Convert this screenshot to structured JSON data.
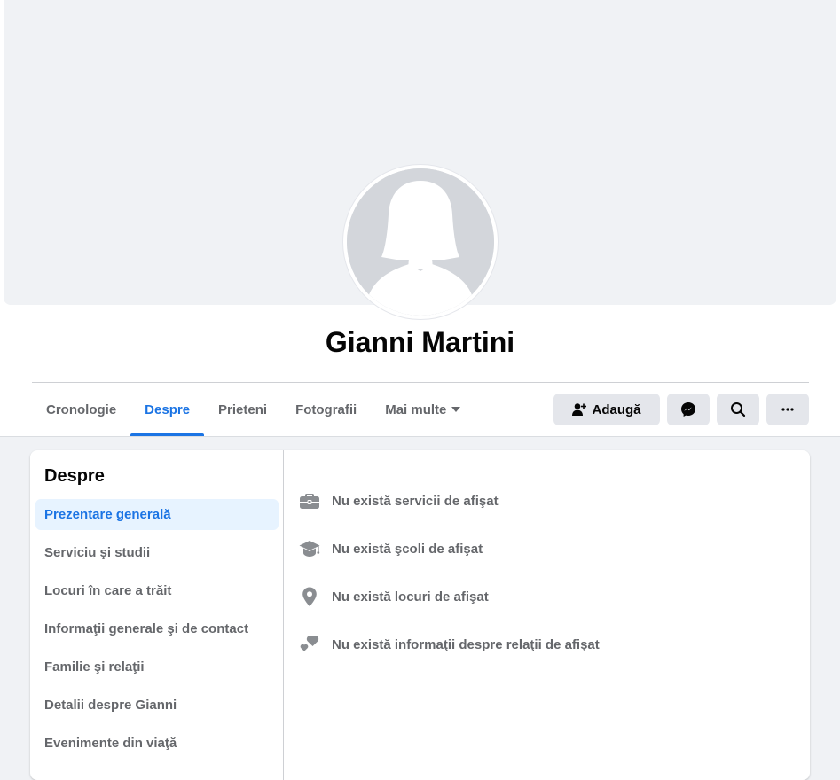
{
  "profile": {
    "name": "Gianni Martini"
  },
  "tabs": [
    {
      "label": "Cronologie"
    },
    {
      "label": "Despre"
    },
    {
      "label": "Prieteni"
    },
    {
      "label": "Fotografii"
    },
    {
      "label": "Mai multe"
    }
  ],
  "actions": {
    "add_label": "Adaugă"
  },
  "about": {
    "title": "Despre",
    "items": [
      {
        "label": "Prezentare generală"
      },
      {
        "label": "Serviciu şi studii"
      },
      {
        "label": "Locuri în care a trăit"
      },
      {
        "label": "Informaţii generale şi de contact"
      },
      {
        "label": "Familie şi relaţii"
      },
      {
        "label": "Detalii despre Gianni"
      },
      {
        "label": "Evenimente din viaţă"
      }
    ],
    "overview": [
      {
        "icon": "briefcase-icon",
        "text": "Nu există servicii de afişat"
      },
      {
        "icon": "graduation-cap-icon",
        "text": "Nu există şcoli de afişat"
      },
      {
        "icon": "location-pin-icon",
        "text": "Nu există locuri de afişat"
      },
      {
        "icon": "hearts-icon",
        "text": "Nu există informaţii despre relaţii de afişat"
      }
    ]
  },
  "colors": {
    "accent": "#1b74e4",
    "accent_bg": "#e7f3ff",
    "secondary_text": "#65676b",
    "button_bg": "#e4e6eb",
    "page_bg": "#f0f2f5"
  }
}
